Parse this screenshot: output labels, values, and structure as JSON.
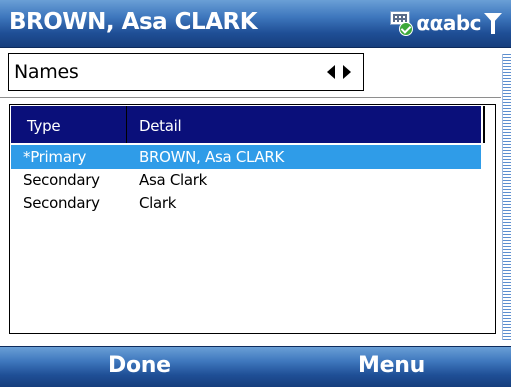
{
  "window": {
    "title": "BROWN, Asa CLARK"
  },
  "status_bar": {
    "input_mode": "ααabc",
    "icons": [
      "keyboard-check-icon",
      "signal-antenna-icon"
    ]
  },
  "picker": {
    "value": "Names"
  },
  "list": {
    "columns": {
      "type": "Type",
      "detail": "Detail"
    },
    "rows": [
      {
        "type": "*Primary",
        "detail": "BROWN, Asa CLARK",
        "selected": true
      },
      {
        "type": "Secondary",
        "detail": "Asa Clark",
        "selected": false
      },
      {
        "type": "Secondary",
        "detail": "Clark",
        "selected": false
      }
    ]
  },
  "softkeys": {
    "left": "Done",
    "right": "Menu"
  },
  "colors": {
    "bar_blue": "#1f4f96",
    "header_navy": "#0a0f7a",
    "selection_blue": "#2f9ce8"
  }
}
